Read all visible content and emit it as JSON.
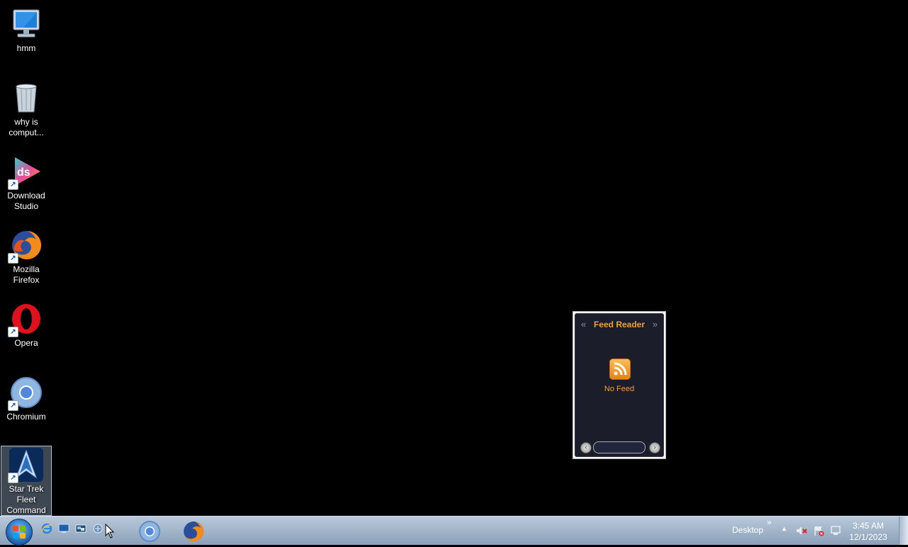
{
  "desktop": {
    "icons": [
      {
        "label": "hmm",
        "icon": "computer-icon"
      },
      {
        "label": "why is comput...",
        "icon": "recycle-bin-icon"
      },
      {
        "label": "Download Studio",
        "icon": "download-studio-icon"
      },
      {
        "label": "Mozilla Firefox",
        "icon": "firefox-icon"
      },
      {
        "label": "Opera",
        "icon": "opera-icon"
      },
      {
        "label": "Chromium",
        "icon": "chromium-icon"
      },
      {
        "label": "Star Trek Fleet Command",
        "icon": "star-trek-icon"
      }
    ]
  },
  "gadget": {
    "title": "Feed Reader",
    "prev": "«",
    "next": "»",
    "status": "No Feed"
  },
  "taskbar": {
    "toolbar_label": "Desktop",
    "toolbar_chevron": "»",
    "time": "3:45 AM",
    "date": "12/1/2023",
    "pinned": [
      "chromium-icon",
      "firefox-icon"
    ],
    "quick_launch": [
      "internet-explorer-icon",
      "show-desktop-icon",
      "switch-windows-icon",
      "network-icon"
    ],
    "tray": [
      "show-hidden-icons",
      "volume-muted-icon",
      "action-center-icon",
      "network-status-icon"
    ]
  }
}
